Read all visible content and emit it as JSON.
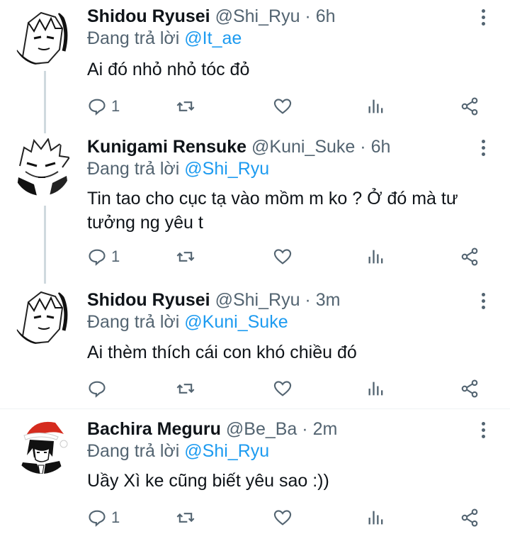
{
  "reply_prefix": "Đang trả lời",
  "tweets": [
    {
      "name": "Shidou Ryusei",
      "handle": "@Shi_Ryu",
      "dot": "·",
      "time": "6h",
      "reply_to": "@It_ae",
      "text": "Ai đó nhỏ nhỏ tóc đỏ",
      "reply_count": "1"
    },
    {
      "name": "Kunigami Rensuke",
      "handle": "@Kuni_Suke",
      "dot": "·",
      "time": "6h",
      "reply_to": "@Shi_Ryu",
      "text": "Tin tao cho cục tạ vào mồm m ko ? Ở đó mà tư tưởng ng yêu t",
      "reply_count": "1"
    },
    {
      "name": "Shidou Ryusei",
      "handle": "@Shi_Ryu",
      "dot": "·",
      "time": "3m",
      "reply_to": "@Kuni_Suke",
      "text": "Ai thèm thích cái con khó chiều đó",
      "reply_count": ""
    },
    {
      "name": "Bachira Meguru",
      "handle": "@Be_Ba",
      "dot": "·",
      "time": "2m",
      "reply_to": "@Shi_Ryu",
      "text": "Uầy Xì ke cũng biết yêu sao :))",
      "reply_count": "1"
    }
  ],
  "icons": {
    "reply": "reply-icon",
    "retweet": "retweet-icon",
    "like": "heart-icon",
    "views": "views-icon",
    "share": "share-icon",
    "more": "more-icon"
  },
  "colors": {
    "mention": "#1d9bf0",
    "secondary_text": "#536471",
    "thread_line": "#cfd9de"
  }
}
